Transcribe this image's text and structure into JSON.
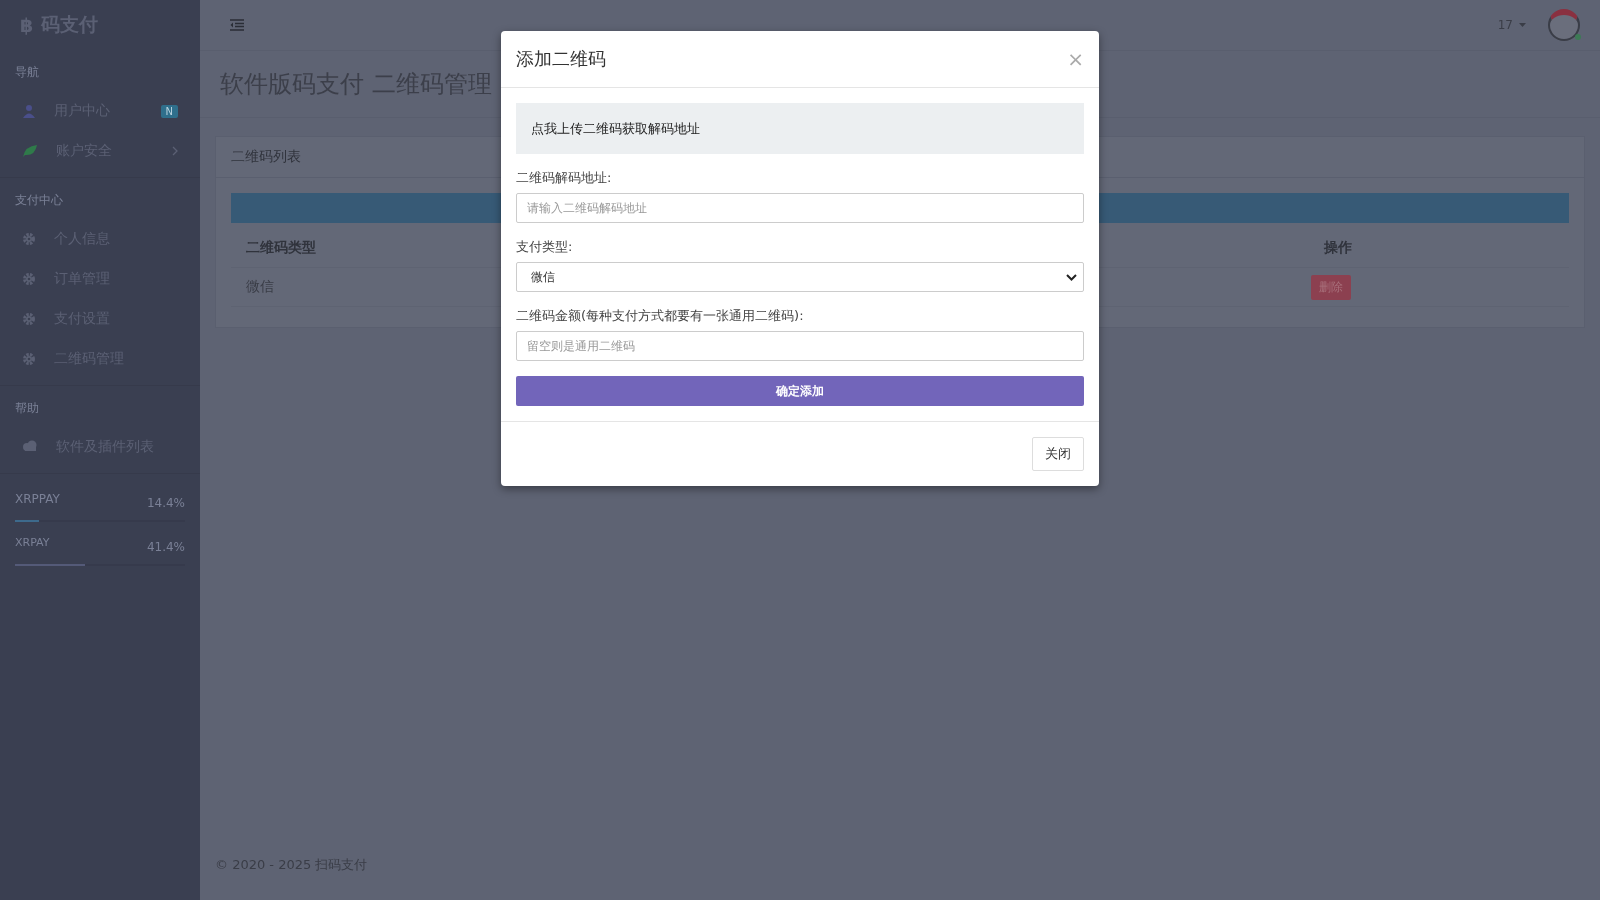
{
  "sidebar": {
    "brand_mark": "฿",
    "brand": "码支付",
    "sections": [
      {
        "title": "导航",
        "items": [
          {
            "label": "用户中心",
            "badge": "N"
          },
          {
            "label": "账户安全",
            "expanded": false
          }
        ]
      },
      {
        "title": "支付中心",
        "items": [
          {
            "label": "个人信息"
          },
          {
            "label": "订单管理"
          },
          {
            "label": "支付设置"
          },
          {
            "label": "二维码管理"
          }
        ]
      },
      {
        "title": "帮助",
        "items": [
          {
            "label": "软件及插件列表"
          }
        ]
      }
    ],
    "meters": [
      {
        "name": "XRPPAY",
        "reading": "14.4%",
        "level": 0.144,
        "color": "#3d6a8c"
      },
      {
        "name": "XRPAY",
        "reading": "41.4%",
        "level": 0.414,
        "color": "#545a78"
      }
    ]
  },
  "header": {
    "user": "17"
  },
  "page_title": "软件版码支付 二维码管理",
  "panel": {
    "title": "二维码列表",
    "columns": [
      "二维码类型",
      "操作"
    ],
    "rows": [
      {
        "type": "微信",
        "action": "删除"
      }
    ]
  },
  "footer": "© 2020 - 2025 扫码支付",
  "modal": {
    "title": "添加二维码",
    "close": "×",
    "upload": "点我上传二维码获取解码地址",
    "fields": [
      {
        "kind": "input",
        "label": "二维码解码地址:",
        "placeholder": "请输入二维码解码地址"
      },
      {
        "kind": "select",
        "label": "支付类型:",
        "value": "微信"
      },
      {
        "kind": "input",
        "label": "二维码金额(每种支付方式都要有一张通用二维码):",
        "placeholder": "留空则是通用二维码"
      }
    ],
    "submit": "确定添加",
    "dismiss": "关闭"
  }
}
